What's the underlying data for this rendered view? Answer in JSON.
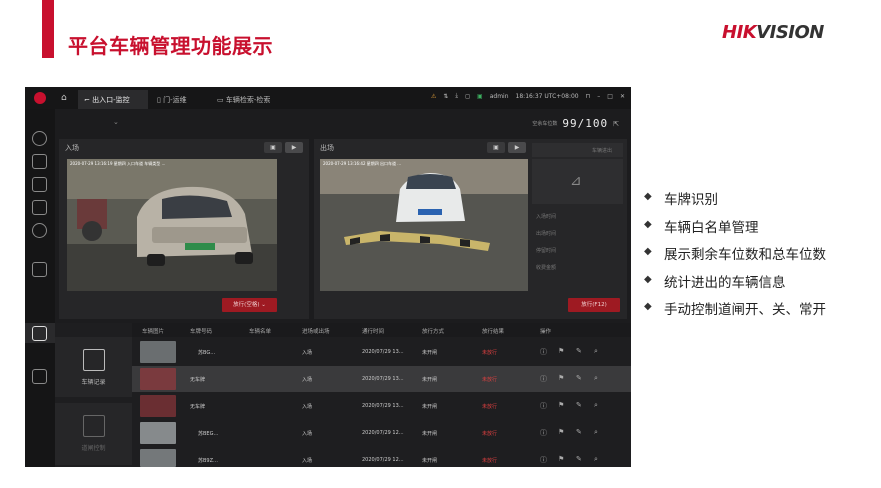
{
  "slide": {
    "title": "平台车辆管理功能展示",
    "logo_red": "HIK",
    "logo_dark": "VISION",
    "brand_color": "#c8102e"
  },
  "app": {
    "tabs": [
      {
        "label": "出入口-监控",
        "icon": "barrier-gate-icon",
        "active": true
      },
      {
        "label": "门-运维",
        "icon": "door-icon",
        "active": false
      },
      {
        "label": "车辆检索-检索",
        "icon": "car-icon",
        "active": false
      }
    ],
    "status": {
      "user": "admin",
      "time": "18:16:37 UTC+08:00"
    },
    "remaining": {
      "label": "空余车位数",
      "value": "99/100"
    },
    "entry_panel": {
      "title": "入场",
      "timestamp": "2020-07-29 13:16:19  星期四  入口车道  车辆类型 ...",
      "button": "放行(空格)"
    },
    "exit_panel": {
      "title": "出场",
      "timestamp": "2020-07-29 13:16:42  星期四  出口车道 ...",
      "info_title": "车辆进出",
      "info_labels": [
        "入场时间",
        "出场时间",
        "停留时间",
        "收费金额"
      ],
      "button": "放行(F12)"
    },
    "left_cards": [
      {
        "label": "车辆记录",
        "icon": "vehicle-record-icon"
      },
      {
        "label": "道闸控制",
        "icon": "gate-control-icon"
      }
    ],
    "table": {
      "headers": [
        "车辆图片",
        "车牌号码",
        "车辆名单",
        "进场或出场",
        "通行时间",
        "放行方式",
        "放行结果",
        "操作"
      ],
      "rows": [
        {
          "plate": "苏BG…",
          "list": "",
          "direction": "入场",
          "time": "2020/07/29 13...",
          "mode": "未开闸",
          "result": "未放行"
        },
        {
          "plate": "无车牌",
          "list": "",
          "direction": "入场",
          "time": "2020/07/29 13...",
          "mode": "未开闸",
          "result": "未放行"
        },
        {
          "plate": "无车牌",
          "list": "",
          "direction": "入场",
          "time": "2020/07/29 13...",
          "mode": "未开闸",
          "result": "未放行"
        },
        {
          "plate": "苏BEG…",
          "list": "",
          "direction": "入场",
          "time": "2020/07/29 12...",
          "mode": "未开闸",
          "result": "未放行"
        },
        {
          "plate": "苏B9Z…",
          "list": "",
          "direction": "入场",
          "time": "2020/07/29 12...",
          "mode": "未开闸",
          "result": "未放行"
        }
      ]
    }
  },
  "bullets": [
    "车牌识别",
    "车辆白名单管理",
    "展示剩余车位数和总车位数",
    "统计进出的车辆信息",
    "手动控制道闸开、关、常开"
  ]
}
